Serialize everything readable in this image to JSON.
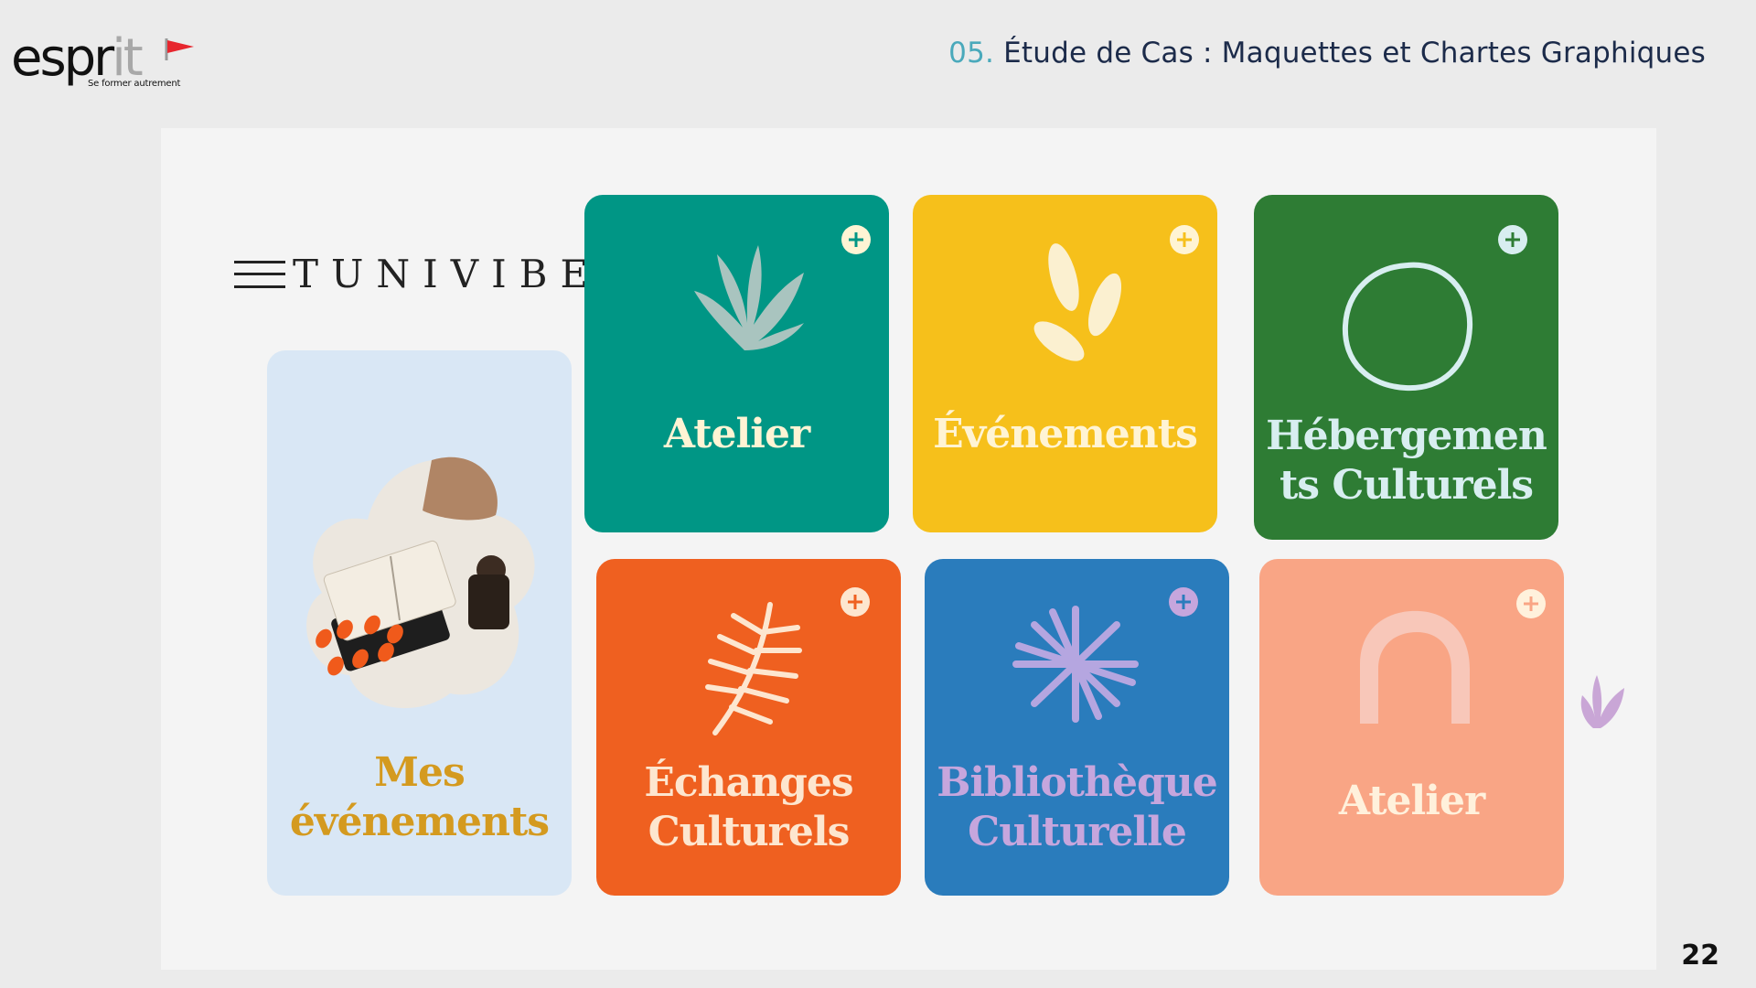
{
  "logo": {
    "main_dark": "espr",
    "main_light": "it",
    "tagline": "Se former autrement"
  },
  "header": {
    "number": "05.",
    "title": " Étude de Cas : Maquettes et Chartes Graphiques"
  },
  "page_number": "22",
  "mockup": {
    "brand": "TUNIVIBE",
    "cards": {
      "mes": {
        "line1": "Mes",
        "line2": "événements",
        "color": "#d9e7f5",
        "text_color": "#d49a1f"
      },
      "atelier1": {
        "line1": "Atelier",
        "color": "#009685",
        "text_color": "#fff4d4"
      },
      "evenements": {
        "line1": "Événements",
        "color": "#f6c01b",
        "text_color": "#fff4d4"
      },
      "hebergements": {
        "line1": "Hébergemen",
        "line2": "ts Culturels",
        "color": "#2e7c34",
        "text_color": "#d8eef0"
      },
      "echanges": {
        "line1": "Échanges",
        "line2": "Culturels",
        "color": "#ef6020",
        "text_color": "#fde6cf"
      },
      "bibliotheque": {
        "line1": "Bibliothèque",
        "line2": "Culturelle",
        "color": "#2a7cbc",
        "text_color": "#c6a6dd"
      },
      "atelier2": {
        "line1": "Atelier",
        "color": "#f9a585",
        "text_color": "#fff1dc"
      }
    },
    "icons": [
      "menu-icon",
      "seaweed-icon",
      "leaves-icon",
      "circle-icon",
      "fern-icon",
      "starburst-icon",
      "arch-icon",
      "plus-icon"
    ]
  }
}
